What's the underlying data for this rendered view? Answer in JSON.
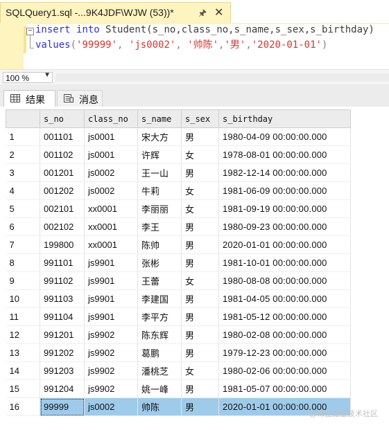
{
  "tab": {
    "title": "SQLQuery1.sql -...9K4JDF\\WJW (53))*",
    "pin_icon": "pin-icon",
    "close_icon": "close-icon"
  },
  "editor": {
    "line1": {
      "kw1": "insert",
      "kw2": "into",
      "rest": "Student(s_no,class_no,s_name,s_sex,s_birthday)"
    },
    "line2": {
      "kw": "values",
      "open": "(",
      "v1": "'99999'",
      "c1": ", ",
      "v2": "'js0002'",
      "c2": ", ",
      "v3": "'帅陈'",
      "c3": ",",
      "v4": "'男'",
      "c4": ",",
      "v5": "'2020-01-01'",
      "close": ")"
    }
  },
  "zoom": {
    "value": "100 %"
  },
  "results_tabs": [
    {
      "label": "结果",
      "icon": "grid-icon"
    },
    {
      "label": "消息",
      "icon": "messages-icon"
    }
  ],
  "grid": {
    "columns": [
      "s_no",
      "class_no",
      "s_name",
      "s_sex",
      "s_birthday"
    ],
    "rows": [
      [
        "1",
        "001101",
        "js0001",
        "宋大方",
        "男",
        "1980-04-09 00:00:00.000"
      ],
      [
        "2",
        "001102",
        "js0001",
        "许辉",
        "女",
        "1978-08-01 00:00:00.000"
      ],
      [
        "3",
        "001201",
        "js0002",
        "王一山",
        "男",
        "1982-12-14 00:00:00.000"
      ],
      [
        "4",
        "001202",
        "js0002",
        "牛莉",
        "女",
        "1981-06-09 00:00:00.000"
      ],
      [
        "5",
        "002101",
        "xx0001",
        "李丽丽",
        "女",
        "1981-09-19 00:00:00.000"
      ],
      [
        "6",
        "002102",
        "xx0001",
        "李王",
        "男",
        "1980-09-23 00:00:00.000"
      ],
      [
        "7",
        "199800",
        "xx0001",
        "陈帅",
        "男",
        "2020-01-01 00:00:00.000"
      ],
      [
        "8",
        "991101",
        "js9901",
        "张彬",
        "男",
        "1981-10-01 00:00:00.000"
      ],
      [
        "9",
        "991102",
        "js9901",
        "王蕾",
        "女",
        "1980-08-08 00:00:00.000"
      ],
      [
        "10",
        "991103",
        "js9901",
        "李建国",
        "男",
        "1981-04-05 00:00:00.000"
      ],
      [
        "11",
        "991104",
        "js9901",
        "李平方",
        "男",
        "1981-05-12 00:00:00.000"
      ],
      [
        "12",
        "991201",
        "js9902",
        "陈东辉",
        "男",
        "1980-02-08 00:00:00.000"
      ],
      [
        "13",
        "991202",
        "js9902",
        "葛鹏",
        "男",
        "1979-12-23 00:00:00.000"
      ],
      [
        "14",
        "991203",
        "js9902",
        "潘桃芝",
        "女",
        "1980-02-06 00:00:00.000"
      ],
      [
        "15",
        "991204",
        "js9902",
        "姚一峰",
        "男",
        "1981-05-07 00:00:00.000"
      ],
      [
        "16",
        "99999",
        "js0002",
        "帅陈",
        "男",
        "2020-01-01 00:00:00.000"
      ]
    ],
    "selected_row": 16
  },
  "watermark": "@稀土掘金技术社区",
  "colors": {
    "tab_bg": "#fdf4bf",
    "selection": "#9fcbeb",
    "keyword": "#2f2fd8",
    "string": "#d9322a"
  }
}
